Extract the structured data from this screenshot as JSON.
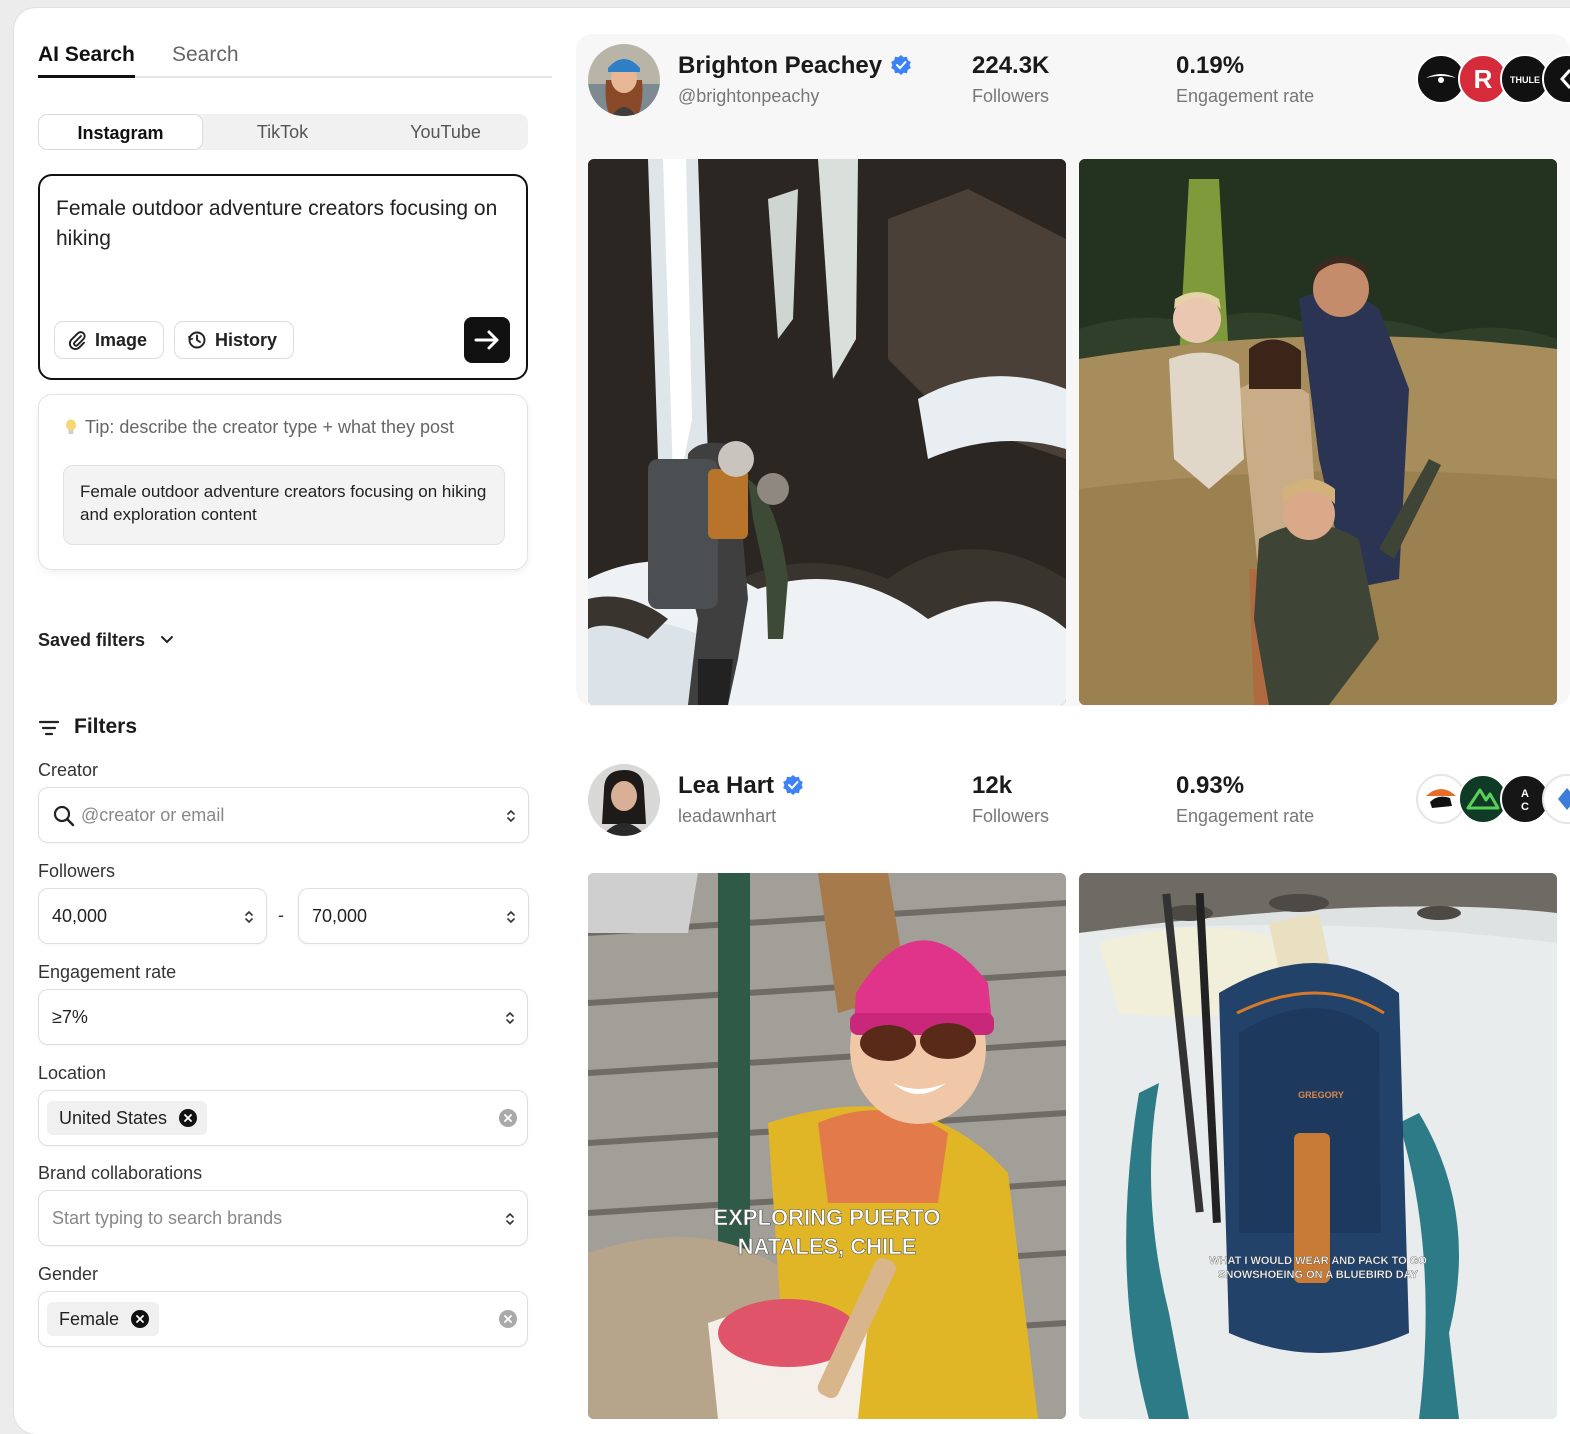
{
  "left": {
    "tabs": {
      "ai_search": "AI Search",
      "search": "Search"
    },
    "platforms": {
      "instagram": "Instagram",
      "tiktok": "TikTok",
      "youtube": "YouTube"
    },
    "query": {
      "text": "Female outdoor adventure creators focusing on hiking",
      "image_label": "Image",
      "history_label": "History"
    },
    "tip": {
      "text": "Tip: describe the creator type + what they post",
      "suggestion": "Female outdoor adventure creators focusing on hiking and exploration content"
    },
    "saved_filters": "Saved filters",
    "filters": {
      "title": "Filters",
      "creator_label": "Creator",
      "creator_placeholder": "@creator or email",
      "followers_label": "Followers",
      "followers_min": "40,000",
      "followers_sep": "-",
      "followers_max": "70,000",
      "engagement_label": "Engagement rate",
      "engagement_value": "≥7%",
      "location_label": "Location",
      "location_chip": "United States",
      "brand_label": "Brand collaborations",
      "brand_placeholder": "Start typing to search brands",
      "gender_label": "Gender",
      "gender_chip": "Female"
    }
  },
  "creators": [
    {
      "name": "Brighton Peachey",
      "handle": "@brightonpeachy",
      "followers": "224.3K",
      "followers_label": "Followers",
      "engagement": "0.19%",
      "engagement_label": "Engagement rate",
      "brand_logos": [
        "osprey",
        "R",
        "THULE",
        "arrow"
      ]
    },
    {
      "name": "Lea Hart",
      "handle": "leadawnhart",
      "followers": "12k",
      "followers_label": "Followers",
      "engagement": "0.93%",
      "engagement_label": "Engagement rate",
      "brand_logos": [
        "bear",
        "mountain",
        "A C",
        "diamond"
      ],
      "photo_captions": {
        "left_line1": "EXPLORING PUERTO",
        "left_line2": "NATALES, CHILE",
        "right_line1": "WHAT I WOULD WEAR AND PACK TO GO",
        "right_line2": "SNOWSHOEING ON A BLUEBIRD DAY",
        "backpack_brand": "GREGORY"
      }
    }
  ],
  "colors": {
    "accent": "#111111",
    "verified": "#3b82f6",
    "chip_bg": "#f0f0f0"
  }
}
